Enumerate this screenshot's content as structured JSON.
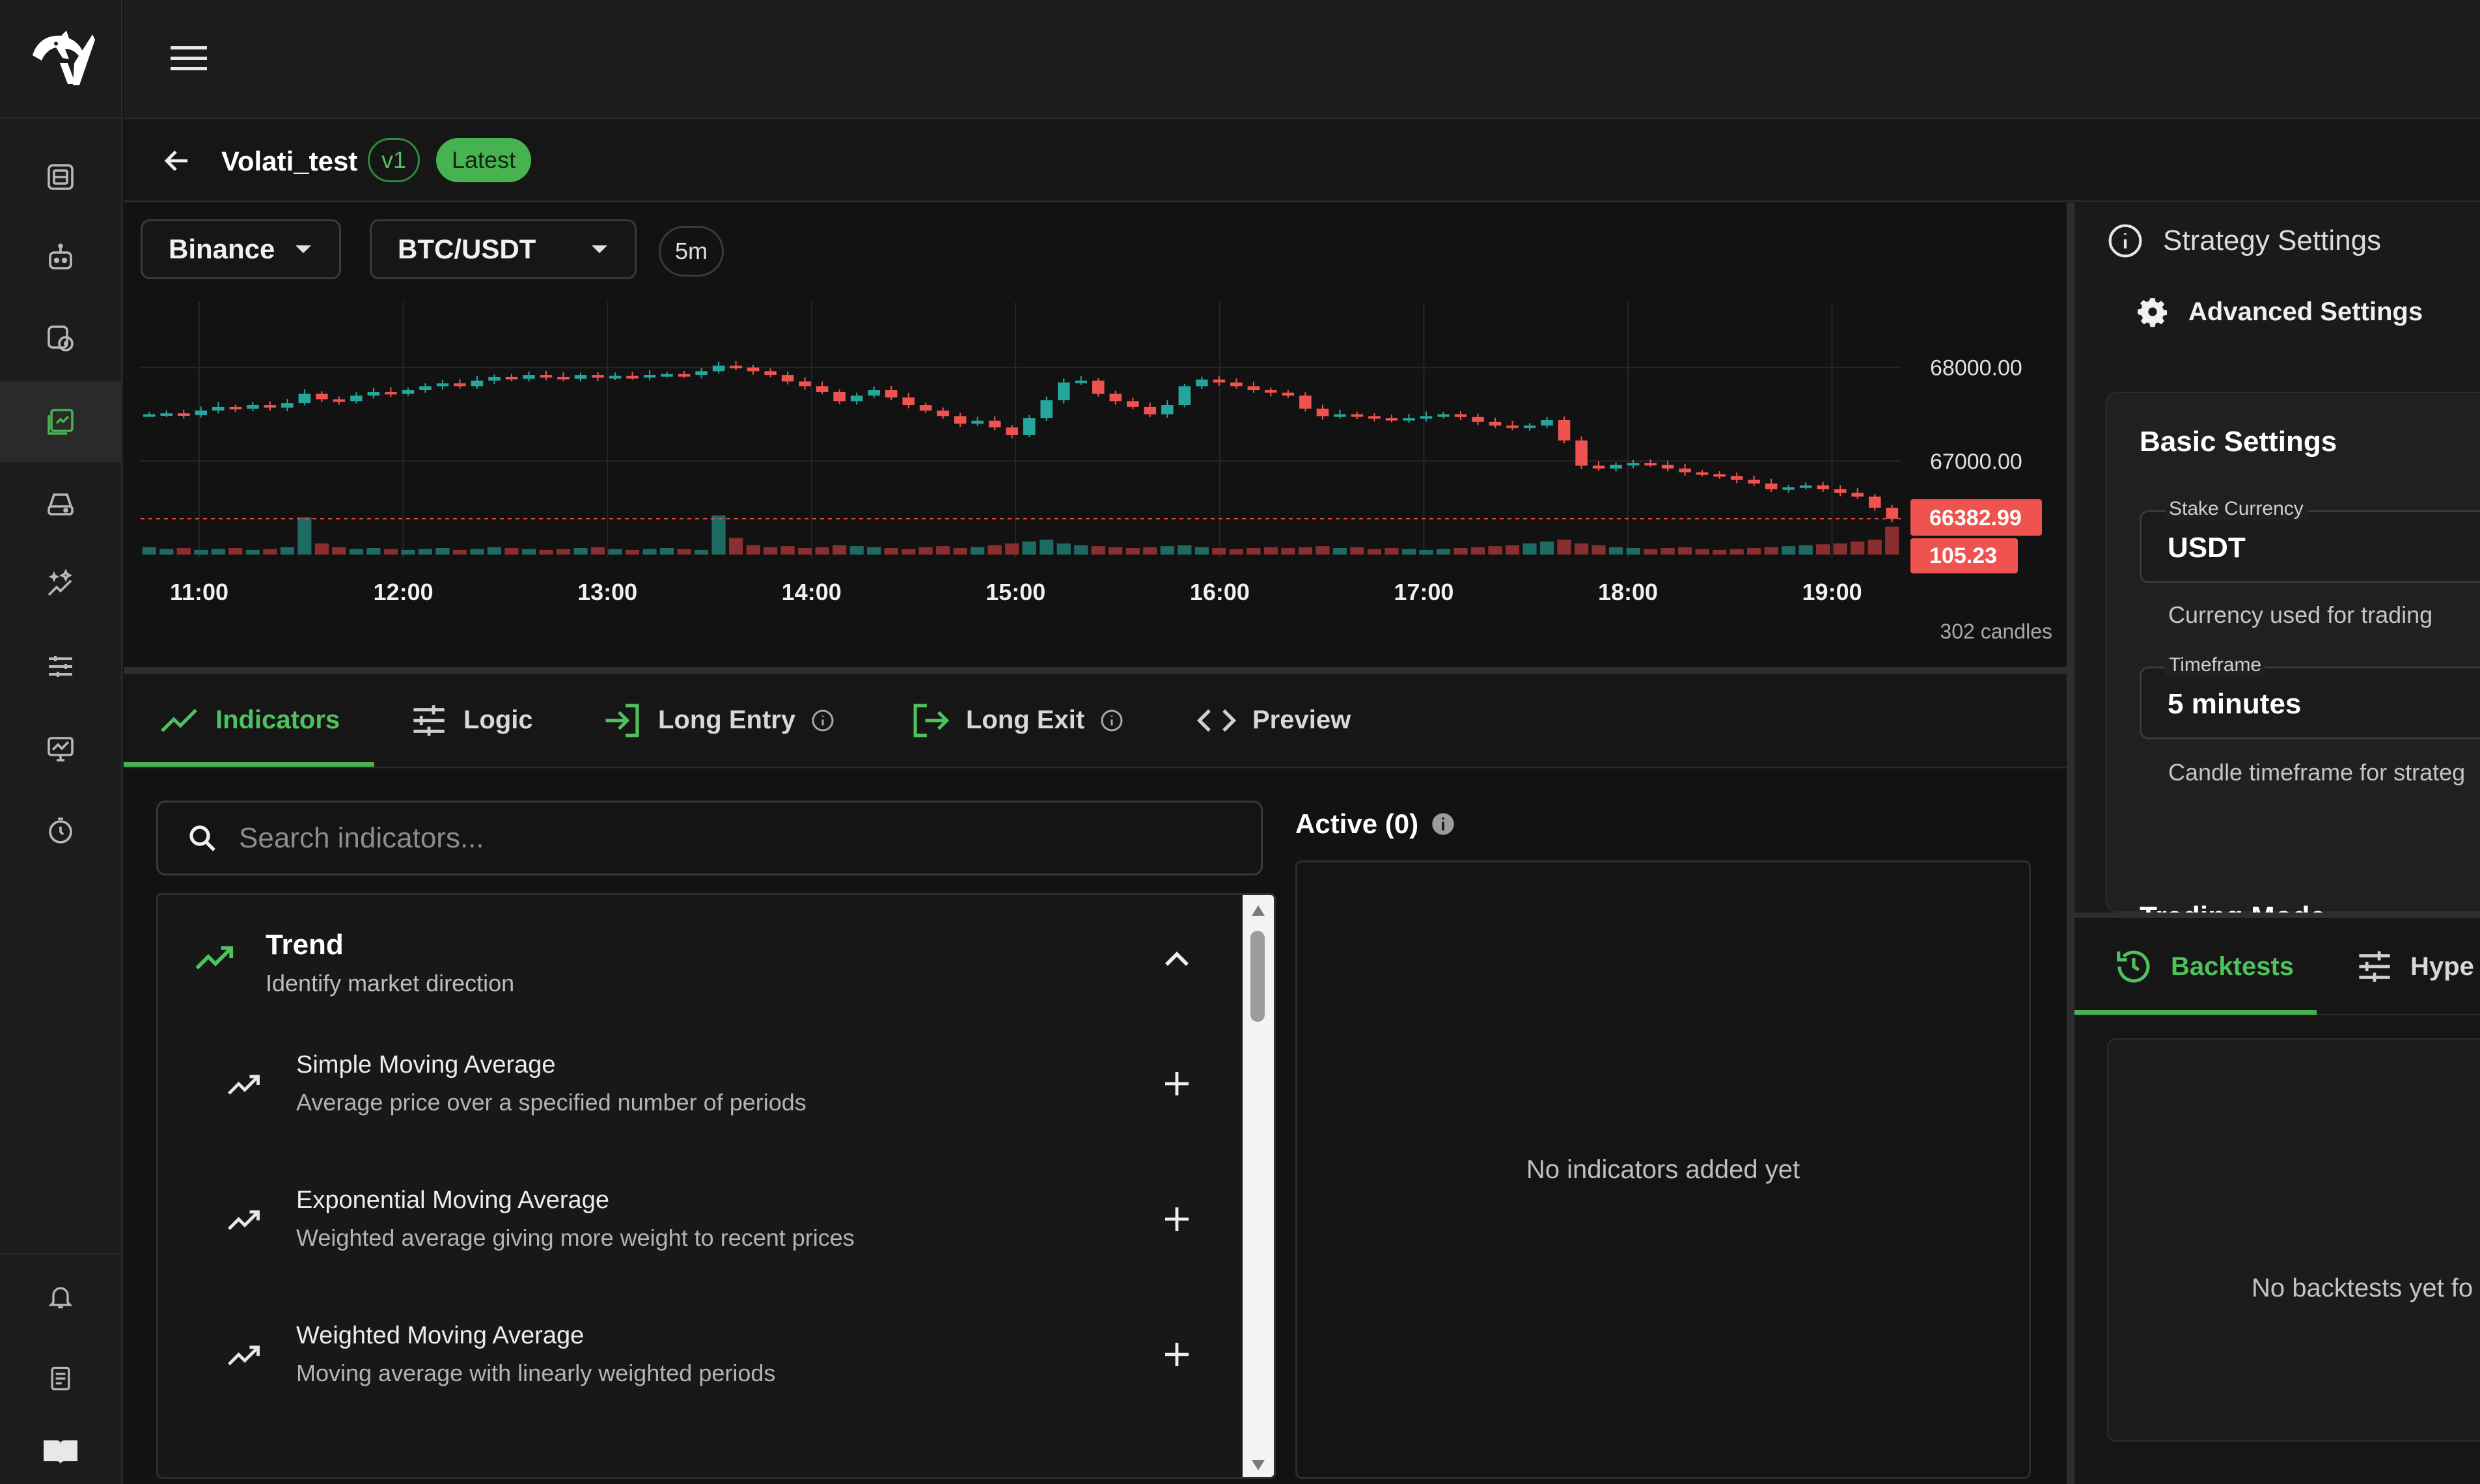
{
  "app": {
    "logo_icon": "horse-logo-icon",
    "menu_icon": "hamburger-menu-icon",
    "accent_color": "#46b350",
    "bear_color": "#ef5350",
    "bull_color": "#26a69a"
  },
  "sidebar": {
    "items": [
      {
        "icon": "dashboard-icon"
      },
      {
        "icon": "bot-icon"
      },
      {
        "icon": "exchange-coin-icon"
      },
      {
        "icon": "strategy-builder-icon",
        "active": true
      },
      {
        "icon": "data-drive-icon"
      },
      {
        "icon": "ai-sparkle-chart-icon"
      },
      {
        "icon": "sliders-icon"
      },
      {
        "icon": "monitor-chart-icon"
      },
      {
        "icon": "timer-icon"
      }
    ],
    "bottom_items": [
      {
        "icon": "notification-bell-icon"
      },
      {
        "icon": "document-icon"
      },
      {
        "icon": "book-icon"
      }
    ]
  },
  "strategy": {
    "name": "Volati_test",
    "version": "v1",
    "status": "Latest"
  },
  "chart_controls": {
    "exchange": "Binance",
    "pair": "BTC/USDT",
    "timeframe": "5m",
    "candle_count": "302 candles"
  },
  "chart_data": {
    "type": "candlestick",
    "x_ticks": [
      "11:00",
      "12:00",
      "13:00",
      "14:00",
      "15:00",
      "16:00",
      "17:00",
      "18:00",
      "19:00"
    ],
    "y_ticks": [
      68000.0,
      67000.0
    ],
    "y_tick_labels": [
      "68000.00",
      "67000.00"
    ],
    "ylim": [
      66000,
      68700
    ],
    "last_price": "66382.99",
    "last_volume": "105.23",
    "closes": [
      67500,
      67510,
      67490,
      67540,
      67580,
      67560,
      67600,
      67570,
      67620,
      67720,
      67660,
      67640,
      67700,
      67740,
      67720,
      67760,
      67800,
      67830,
      67800,
      67860,
      67900,
      67880,
      67920,
      67900,
      67880,
      67920,
      67890,
      67910,
      67900,
      67920,
      67930,
      67920,
      67960,
      68020,
      68000,
      67960,
      67920,
      67850,
      67800,
      67740,
      67640,
      67700,
      67760,
      67680,
      67600,
      67540,
      67480,
      67400,
      67430,
      67360,
      67280,
      67460,
      67650,
      67840,
      67860,
      67720,
      67640,
      67580,
      67500,
      67600,
      67800,
      67870,
      67840,
      67800,
      67760,
      67730,
      67700,
      67560,
      67480,
      67500,
      67480,
      67460,
      67440,
      67460,
      67480,
      67500,
      67470,
      67420,
      67380,
      67360,
      67380,
      67440,
      67220,
      66950,
      66920,
      66960,
      66980,
      66960,
      66920,
      66880,
      66860,
      66840,
      66800,
      66760,
      66700,
      66720,
      66740,
      66700,
      66660,
      66620,
      66500,
      66383
    ],
    "volumes": [
      8,
      6,
      7,
      5,
      6,
      7,
      5,
      6,
      8,
      40,
      12,
      8,
      6,
      7,
      6,
      5,
      6,
      7,
      5,
      6,
      8,
      7,
      6,
      5,
      6,
      7,
      8,
      6,
      5,
      6,
      7,
      6,
      5,
      42,
      18,
      10,
      8,
      9,
      7,
      8,
      10,
      9,
      8,
      7,
      6,
      8,
      9,
      7,
      8,
      10,
      12,
      14,
      16,
      12,
      10,
      9,
      8,
      7,
      8,
      9,
      10,
      8,
      7,
      6,
      7,
      8,
      7,
      8,
      9,
      7,
      8,
      6,
      7,
      6,
      5,
      6,
      7,
      8,
      9,
      10,
      12,
      14,
      16,
      12,
      10,
      8,
      7,
      6,
      7,
      8,
      6,
      5,
      6,
      7,
      8,
      9,
      10,
      11,
      12,
      14,
      16,
      30
    ],
    "grid": true
  },
  "tabs": [
    {
      "label": "Indicators",
      "icon": "trend-line-icon",
      "active": true
    },
    {
      "label": "Logic",
      "icon": "sliders-icon"
    },
    {
      "label": "Long Entry",
      "icon": "enter-arrow-icon",
      "info": true
    },
    {
      "label": "Long Exit",
      "icon": "exit-arrow-icon",
      "info": true
    },
    {
      "label": "Preview",
      "icon": "code-brackets-icon"
    }
  ],
  "indicators": {
    "search_placeholder": "Search indicators...",
    "group": {
      "title": "Trend",
      "subtitle": "Identify market direction"
    },
    "items": [
      {
        "title": "Simple Moving Average",
        "subtitle": "Average price over a specified number of periods"
      },
      {
        "title": "Exponential Moving Average",
        "subtitle": "Weighted average giving more weight to recent prices"
      },
      {
        "title": "Weighted Moving Average",
        "subtitle": "Moving average with linearly weighted periods"
      }
    ],
    "active_label": "Active (0)",
    "empty_text": "No indicators added yet"
  },
  "settings": {
    "header": "Strategy Settings",
    "advanced": "Advanced Settings",
    "basic_title": "Basic Settings",
    "stake_label": "Stake Currency",
    "stake_value": "USDT",
    "stake_help": "Currency used for trading",
    "timeframe_label": "Timeframe",
    "timeframe_value": "5 minutes",
    "timeframe_help": "Candle timeframe for strateg",
    "trading_mode": "Trading Mode"
  },
  "results": {
    "tab_backtests": "Backtests",
    "tab_hyper": "Hype",
    "empty_text": "No backtests yet fo"
  }
}
